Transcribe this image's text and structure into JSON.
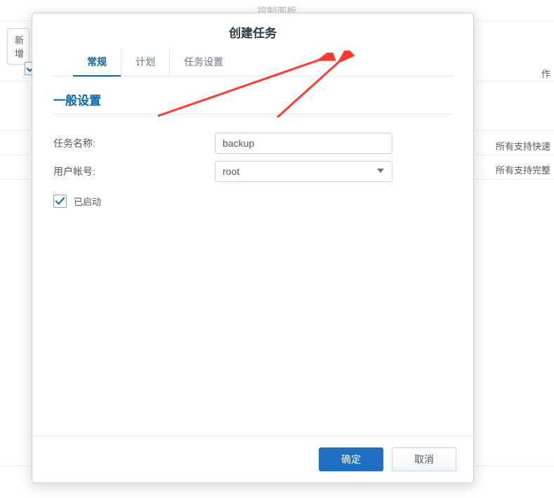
{
  "background": {
    "header": "控制面板",
    "new_button": "新增",
    "right_col_header": "作",
    "right_row1": "所有支持快速",
    "right_row2": "所有支持完整"
  },
  "dialog": {
    "title": "创建任务",
    "tabs": {
      "general": "常规",
      "schedule": "计划",
      "task_settings": "任务设置"
    },
    "section_heading": "一般设置",
    "fields": {
      "task_name_label": "任务名称:",
      "task_name_value": "backup",
      "user_label": "用户帐号:",
      "user_value": "root",
      "enabled_label": "已启动"
    },
    "buttons": {
      "ok": "确定",
      "cancel": "取消"
    }
  },
  "annotation": {
    "arrow_color": "#ff3a2f"
  }
}
